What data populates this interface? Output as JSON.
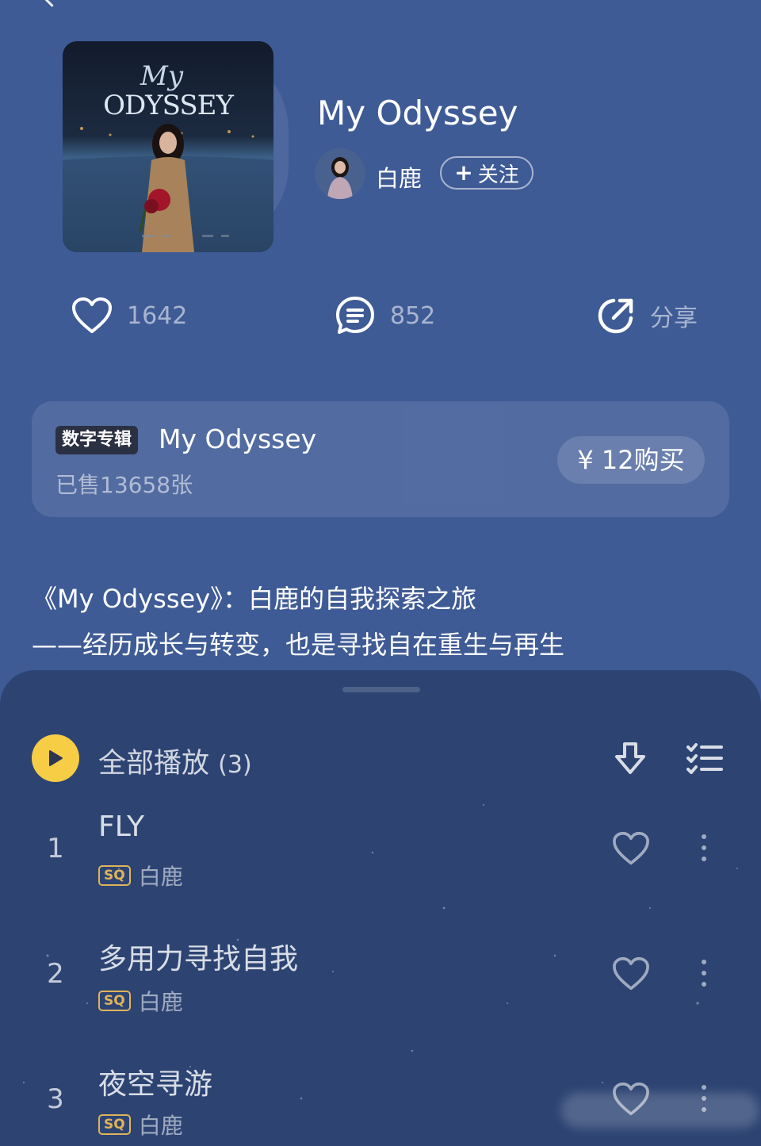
{
  "album": {
    "title": "My Odyssey",
    "cover_art_text": "My ODYSSEY",
    "artist": "白鹿",
    "follow_label": "关注"
  },
  "actions": {
    "likes": "1642",
    "comments": "852",
    "share_label": "分享"
  },
  "digital_album": {
    "badge": "数字专辑",
    "title": "My Odyssey",
    "sold": "已售13658张",
    "buy_label": "¥ 12购买"
  },
  "description": {
    "line1": "《My Odyssey》：白鹿的自我探索之旅",
    "line2": "——经历成长与转变，也是寻找自在重生与再生"
  },
  "tracklist": {
    "play_all_label": "全部播放",
    "count": "(3)",
    "songs": [
      {
        "index": "1",
        "title": "FLY",
        "quality": "SQ",
        "artist": "白鹿"
      },
      {
        "index": "2",
        "title": "多用力寻找自我",
        "quality": "SQ",
        "artist": "白鹿"
      },
      {
        "index": "3",
        "title": "夜空寻游",
        "quality": "SQ",
        "artist": "白鹿"
      }
    ]
  },
  "colors": {
    "background": "#3f5b96",
    "sheet": "#2d4473",
    "play_button": "#f7cd45",
    "sq_badge": "#e0b35a"
  },
  "icons": [
    "back-icon",
    "heart-icon",
    "comment-icon",
    "share-icon",
    "play-icon",
    "download-icon",
    "multiselect-icon",
    "more-icon"
  ]
}
